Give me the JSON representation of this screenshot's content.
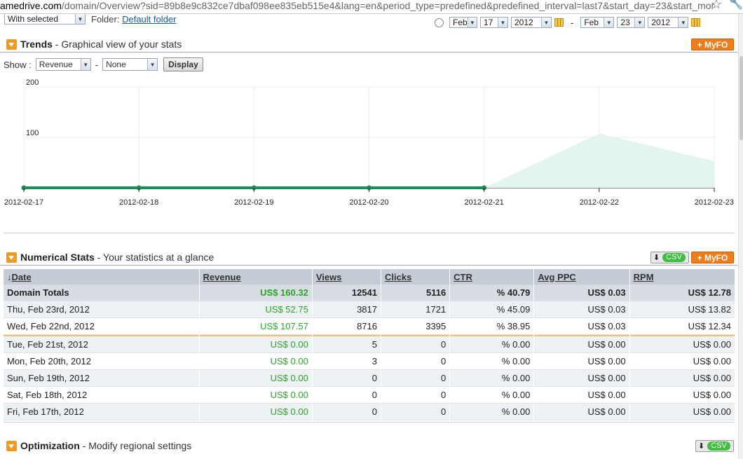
{
  "browser": {
    "url_prefix": "amedrive.com",
    "url_rest": "/domain/Overview?sid=89b8e9c832ce7dbaf098ee835eb515e4&lang=en&period_type=predefined&predefined_interval=last7&start_day=23&start_mor"
  },
  "toolbar": {
    "with_selected": "With selected",
    "folder_label": "Folder:",
    "folder_link": "Default folder"
  },
  "daterange": {
    "from_month": "Feb",
    "from_day": "17",
    "from_year": "2012",
    "separator": "-",
    "to_month": "Feb",
    "to_day": "23",
    "to_year": "2012"
  },
  "trends": {
    "title": "Trends",
    "subtitle": "- Graphical view of your stats",
    "myfo_label": "+ MyFO",
    "show_label": "Show :",
    "metric1": "Revenue",
    "dash": "-",
    "metric2": "None",
    "display_label": "Display"
  },
  "colors": {
    "accent": "#f07d1a",
    "line": "#1e8c5a",
    "area": "#e4f5f1",
    "money": "#2aa52a",
    "header_bg": "#c5ccd6"
  },
  "chart_data": {
    "type": "area",
    "x": [
      "2012-02-17",
      "2012-02-18",
      "2012-02-19",
      "2012-02-20",
      "2012-02-21",
      "2012-02-22",
      "2012-02-23"
    ],
    "series": [
      {
        "values": [
          0,
          0,
          0,
          0,
          0,
          107.57,
          52.75
        ]
      }
    ],
    "yticks": [
      "100",
      "200"
    ],
    "ylim": [
      0,
      200
    ],
    "grid": true
  },
  "numerical": {
    "title": "Numerical Stats",
    "subtitle": "- Your statistics at a glance",
    "csv_label": "CSV",
    "myfo_label": "+ MyFO",
    "columns": [
      "Date",
      "Revenue",
      "Views",
      "Clicks",
      "CTR",
      "Avg PPC",
      "RPM"
    ],
    "totals": [
      "Domain Totals",
      "US$ 160.32",
      "12541",
      "5116",
      "% 40.79",
      "US$ 0.03",
      "US$ 12.78"
    ],
    "rows": [
      [
        "Thu, Feb 23rd, 2012",
        "US$ 52.75",
        "3817",
        "1721",
        "% 45.09",
        "US$ 0.03",
        "US$ 13.82"
      ],
      [
        "Wed, Feb 22nd, 2012",
        "US$ 107.57",
        "8716",
        "3395",
        "% 38.95",
        "US$ 0.03",
        "US$ 12.34"
      ],
      [
        "Tue, Feb 21st, 2012",
        "US$ 0.00",
        "5",
        "0",
        "% 0.00",
        "US$ 0.00",
        "US$ 0.00"
      ],
      [
        "Mon, Feb 20th, 2012",
        "US$ 0.00",
        "3",
        "0",
        "% 0.00",
        "US$ 0.00",
        "US$ 0.00"
      ],
      [
        "Sun, Feb 19th, 2012",
        "US$ 0.00",
        "0",
        "0",
        "% 0.00",
        "US$ 0.00",
        "US$ 0.00"
      ],
      [
        "Sat, Feb 18th, 2012",
        "US$ 0.00",
        "0",
        "0",
        "% 0.00",
        "US$ 0.00",
        "US$ 0.00"
      ],
      [
        "Fri, Feb 17th, 2012",
        "US$ 0.00",
        "0",
        "0",
        "% 0.00",
        "US$ 0.00",
        "US$ 0.00"
      ]
    ]
  },
  "optimization": {
    "title": "Optimization",
    "subtitle": "- Modify regional settings",
    "csv_label": "CSV"
  }
}
